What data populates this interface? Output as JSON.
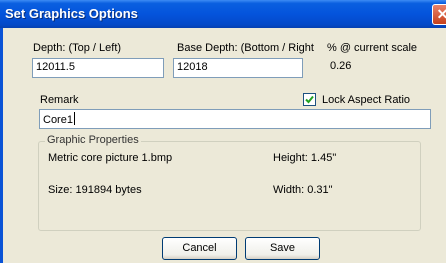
{
  "window": {
    "title": "Set Graphics Options",
    "close_glyph": "✕"
  },
  "fields": {
    "depth": {
      "label": "Depth: (Top / Left)",
      "value": "12011.5"
    },
    "base_depth": {
      "label": "Base Depth: (Bottom / Right",
      "value": "12018"
    },
    "scale": {
      "label": "% @ current scale",
      "value": "0.26"
    },
    "remark": {
      "label": "Remark",
      "value": "Core1"
    }
  },
  "lock_aspect": {
    "label": "Lock Aspect Ratio",
    "checked": true
  },
  "graphic_properties": {
    "title": "Graphic Properties",
    "filename": "Metric core picture 1.bmp",
    "size": "Size: 191894 bytes",
    "height": "Height: 1.45\"",
    "width": "Width: 0.31\""
  },
  "buttons": {
    "cancel": "Cancel",
    "save": "Save"
  },
  "colors": {
    "titlebar": "#0454dc",
    "dialog_bg": "#ece9d8",
    "input_border": "#7f9db9"
  },
  "icons": {
    "close": "close-icon",
    "check": "check-icon"
  }
}
